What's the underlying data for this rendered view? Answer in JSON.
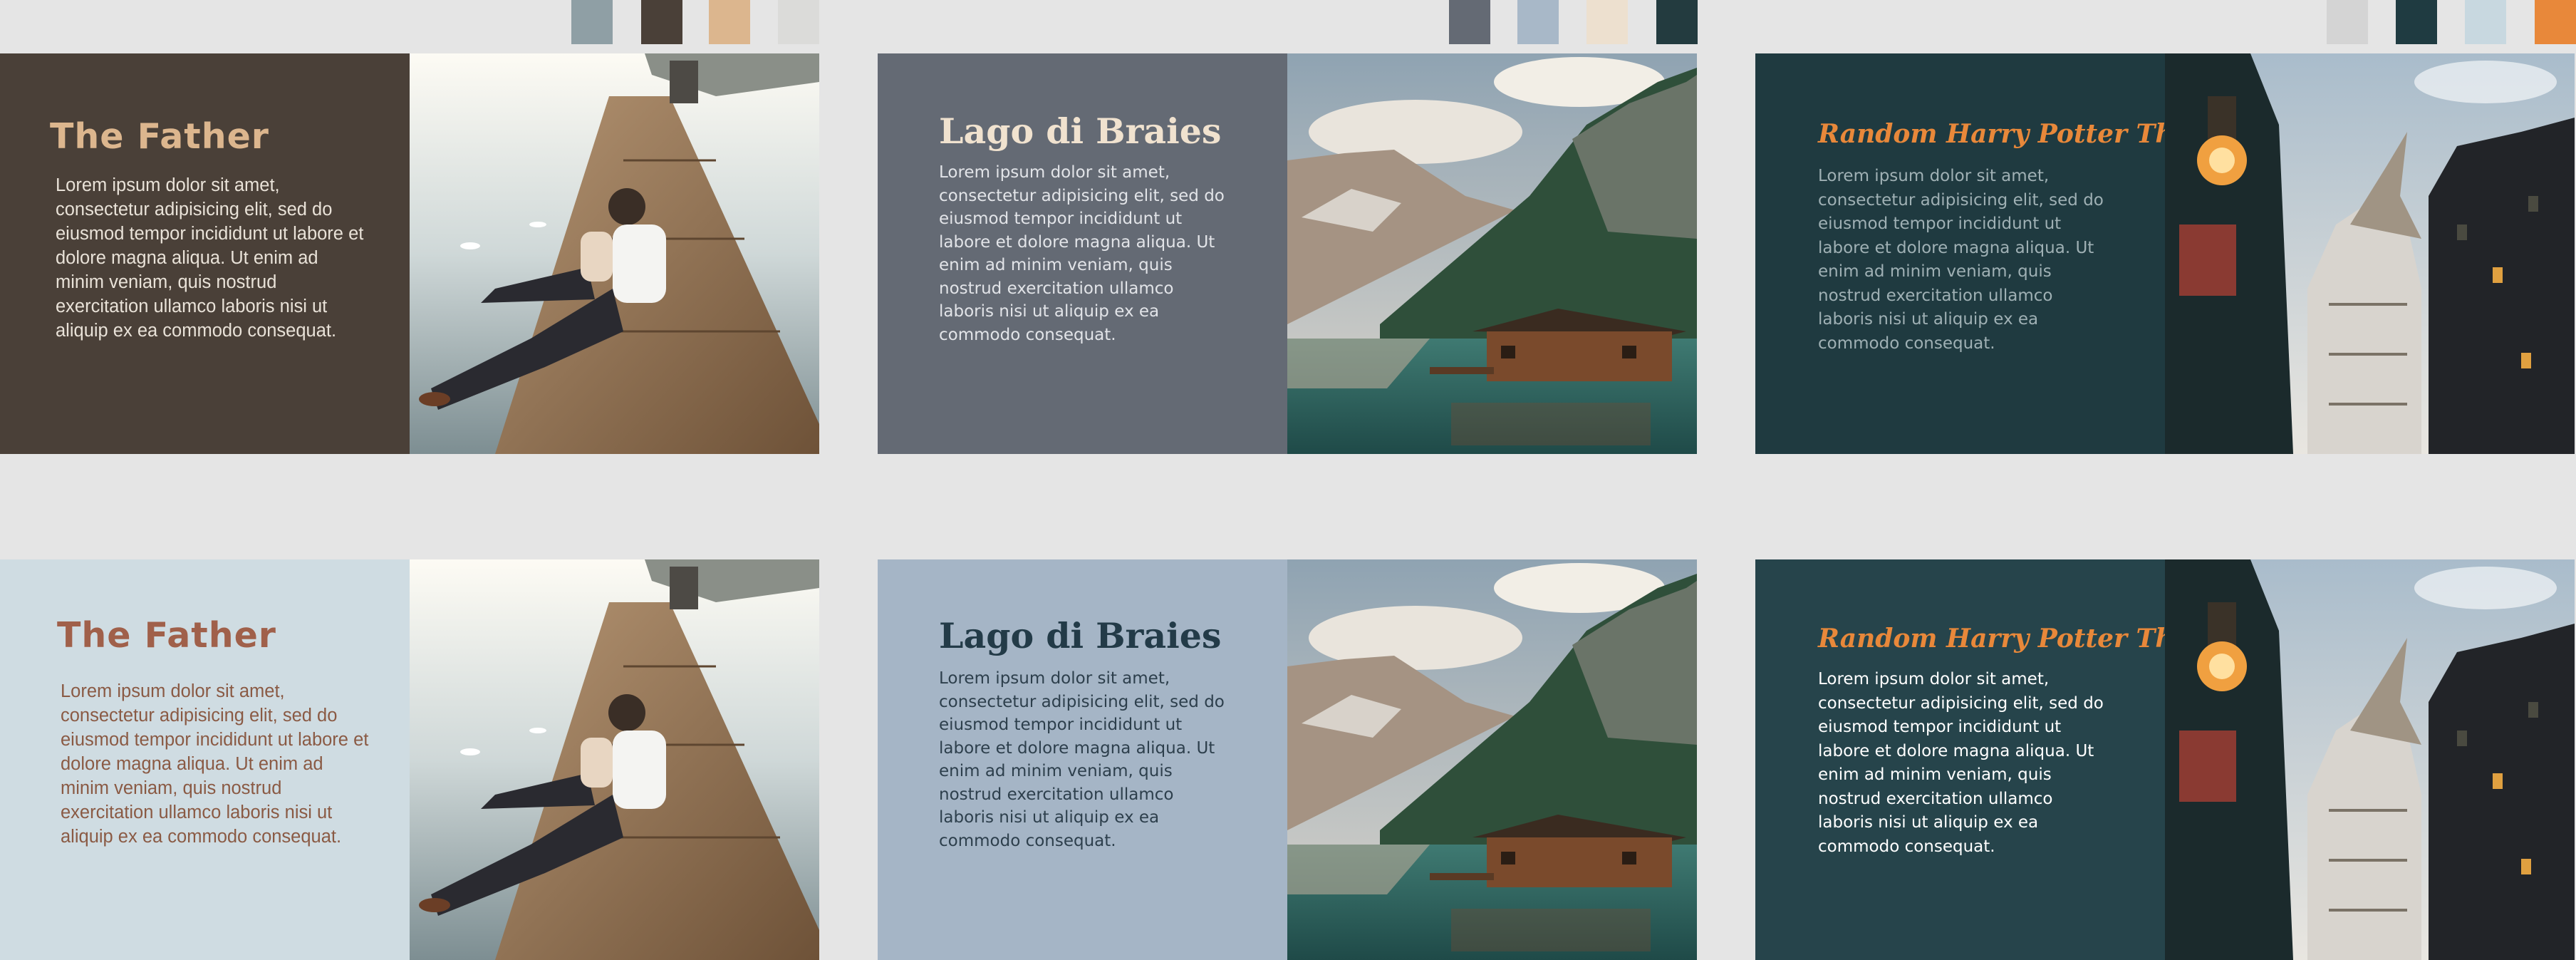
{
  "palettes": {
    "father": [
      "#8f9fa5",
      "#4a4038",
      "#dcb68e",
      "#dbdbd9"
    ],
    "braies": [
      "#646a74",
      "#a8b8c8",
      "#ede0cf",
      "#233b3f"
    ],
    "potter": [
      "#d4d4d4",
      "#1f3b41",
      "#c8d8e0",
      "#e8883a"
    ]
  },
  "cards": {
    "father": {
      "title": "The Father",
      "body": "Lorem ipsum dolor sit amet, consectetur adipisicing elit, sed do eiusmod tempor incididunt ut labore et dolore magna aliqua. Ut enim ad minim veniam, quis nostrud exercitation ullamco laboris nisi ut aliquip ex ea commodo consequat."
    },
    "braies": {
      "title": "Lago di Braies",
      "body": "Lorem ipsum dolor sit amet, consectetur adipisicing elit, sed do eiusmod tempor incididunt ut labore et dolore magna aliqua. Ut enim ad minim veniam, quis nostrud exercitation ullamco laboris nisi ut aliquip ex ea commodo consequat."
    },
    "potter": {
      "title": "Random Harry Potter Thing",
      "body": "Lorem ipsum dolor sit amet, consectetur adipisicing elit, sed do eiusmod tempor incididunt ut labore et dolore magna aliqua. Ut enim ad minim veniam, quis nostrud exercitation ullamco laboris nisi ut aliquip ex ea commodo consequat."
    }
  },
  "colors": {
    "father_dark_bg": "#4a4038",
    "father_dark_title": "#dcb68e",
    "father_dark_text": "#e9e2d8",
    "father_light_bg": "#cfdce2",
    "father_light_title": "#a0604a",
    "father_light_text": "#8a5a44",
    "braies_dark_bg": "#646a74",
    "braies_dark_title": "#f0e2cf",
    "braies_dark_text": "#e2e4e8",
    "braies_light_bg": "#a5b5c6",
    "braies_light_title": "#233b48",
    "braies_light_text": "#2d3f4c",
    "potter_dark_bg": "#1f3a40",
    "potter_dark_title": "#e8883a",
    "potter_dark_text": "#9fb0b4",
    "potter_light_bg": "#26444b",
    "potter_light_title": "#e8883a",
    "potter_light_text": "#ffffff"
  },
  "images": {
    "father": "father-and-child-on-dock-photo",
    "braies": "lake-cabin-mountains-photo",
    "potter": "castle-street-lanterns-photo"
  }
}
